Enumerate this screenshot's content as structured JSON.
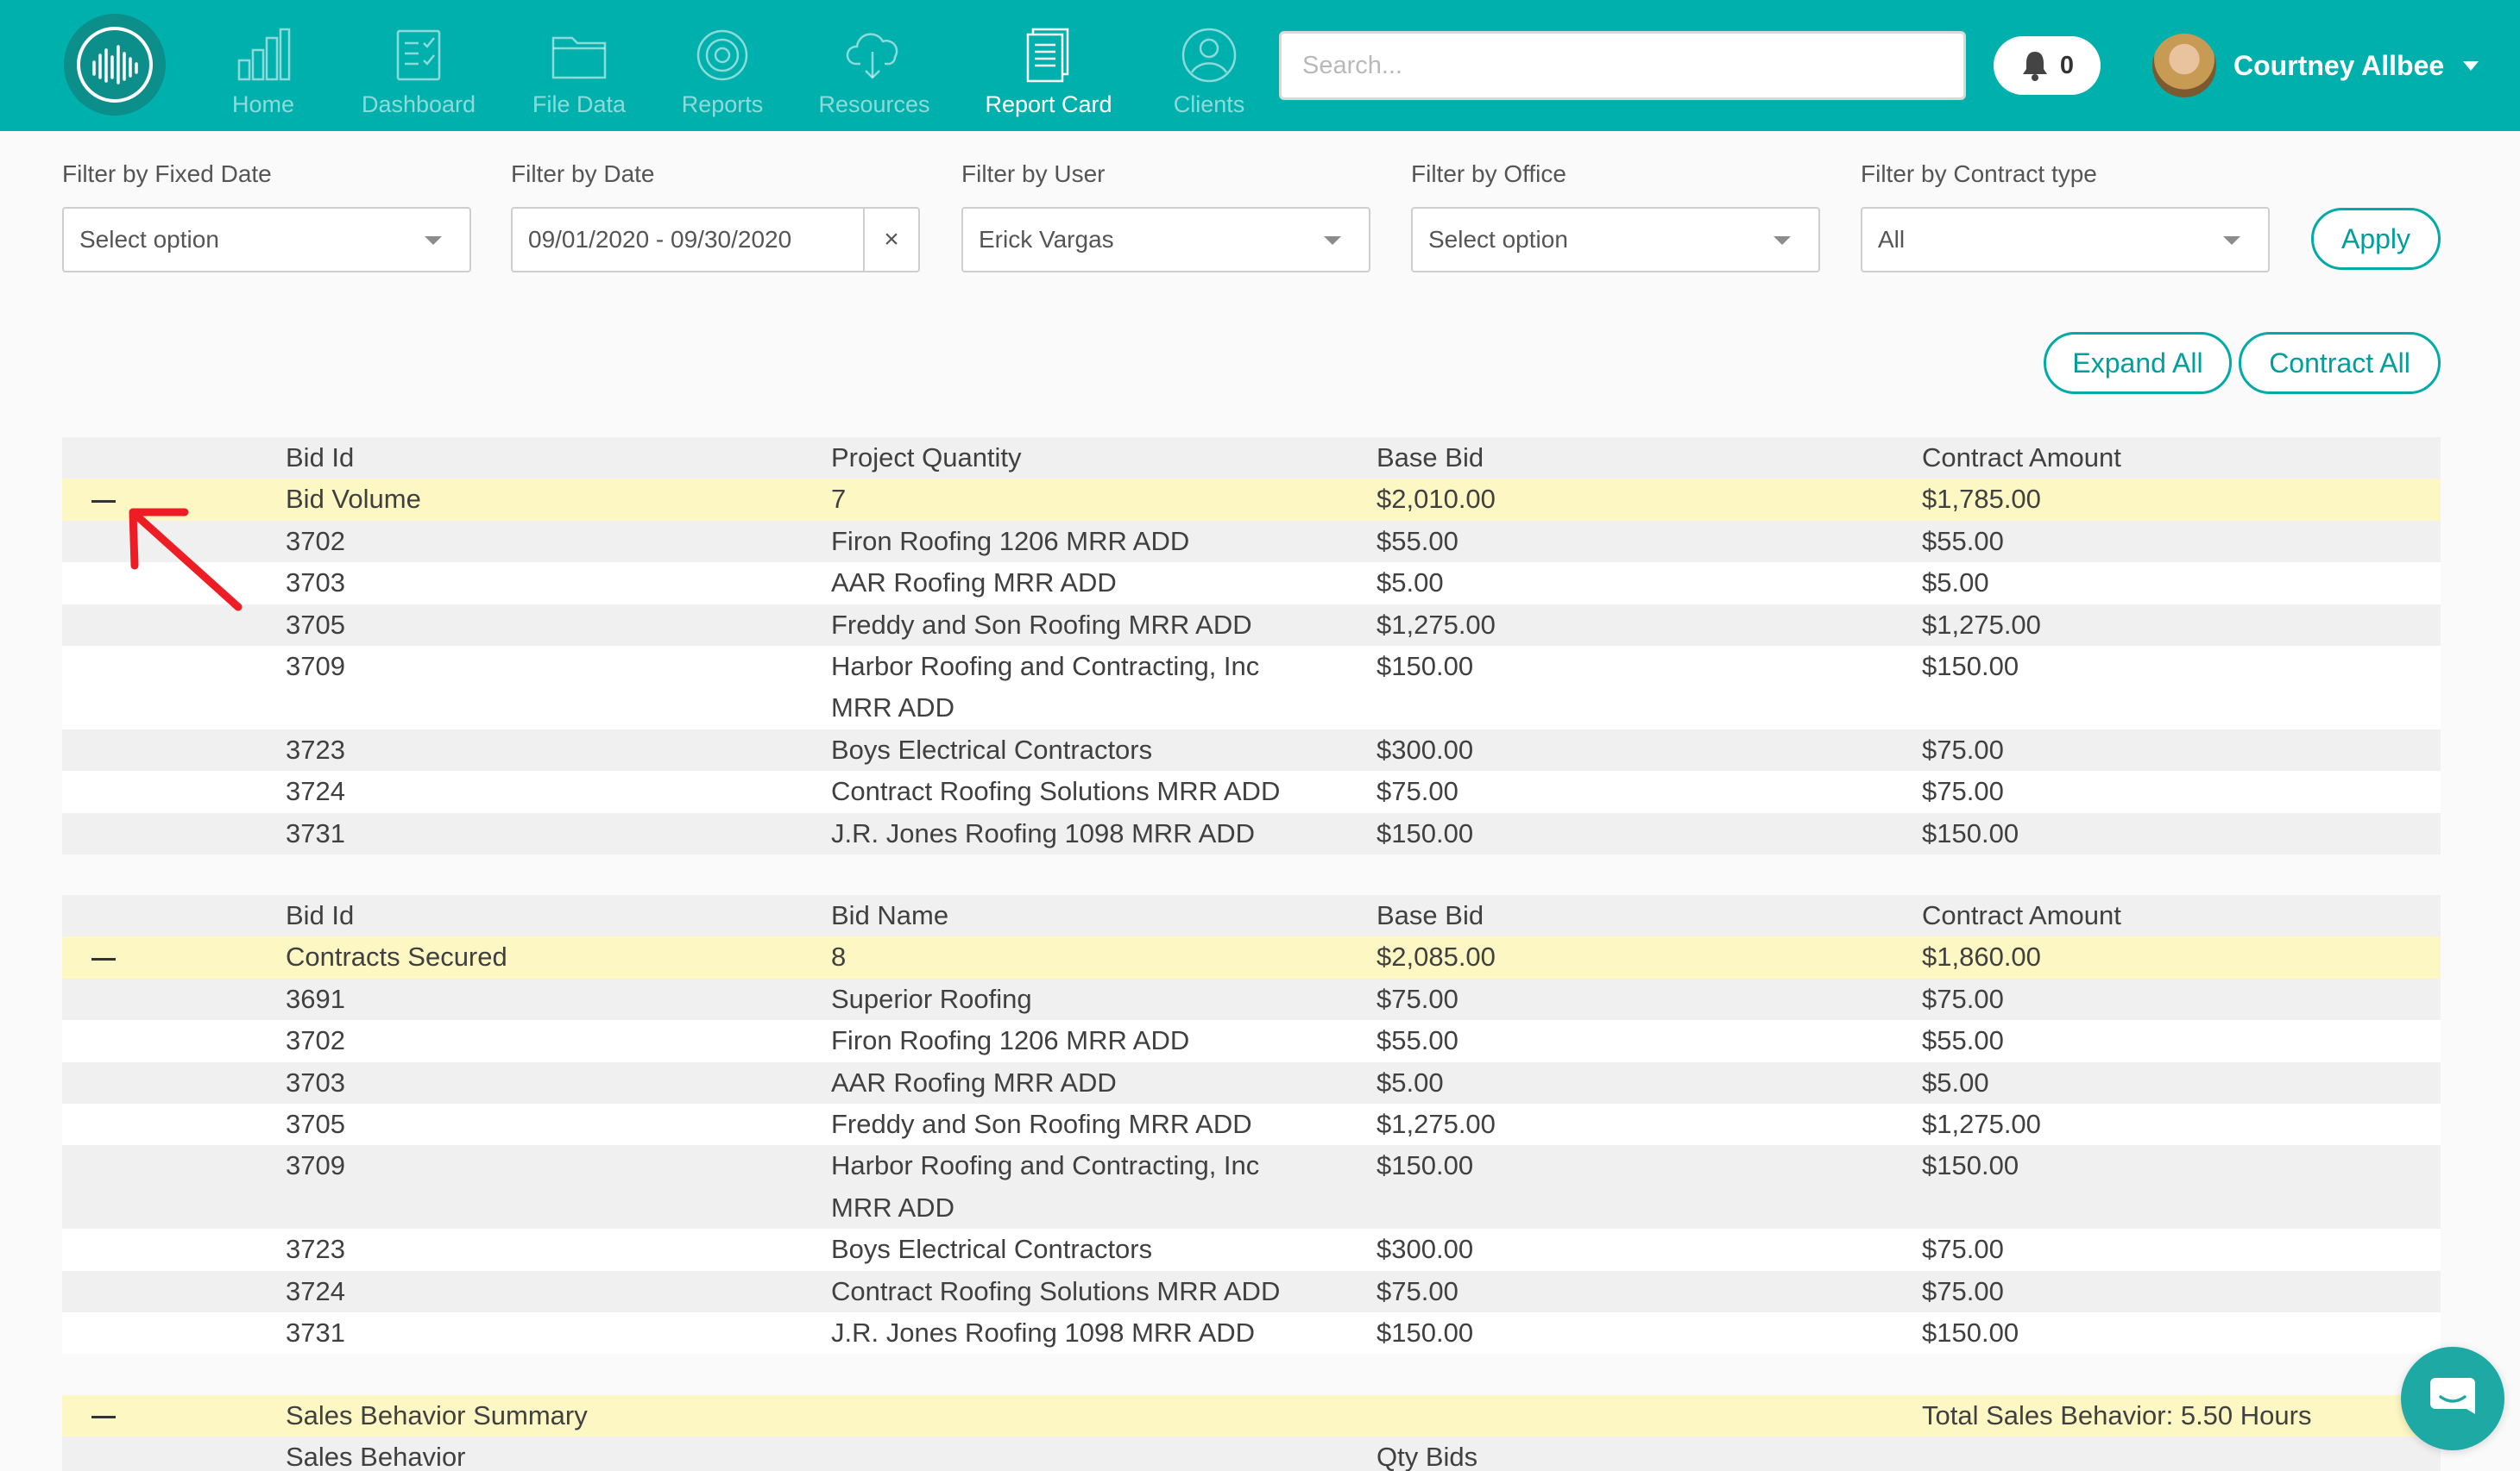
{
  "nav": {
    "items": [
      {
        "label": "Home",
        "icon": "bar-chart-icon"
      },
      {
        "label": "Dashboard",
        "icon": "clipboard-check-icon"
      },
      {
        "label": "File Data",
        "icon": "folder-icon"
      },
      {
        "label": "Reports",
        "icon": "target-icon"
      },
      {
        "label": "Resources",
        "icon": "cloud-download-icon"
      },
      {
        "label": "Report Card",
        "icon": "document-icon"
      },
      {
        "label": "Clients",
        "icon": "user-circle-icon"
      }
    ],
    "active": "Report Card",
    "search_placeholder": "Search...",
    "notification_count": "0",
    "user_name": "Courtney Allbee"
  },
  "filters": {
    "fixed_date": {
      "label": "Filter by Fixed Date",
      "value": "Select option"
    },
    "date": {
      "label": "Filter by Date",
      "value": "09/01/2020 - 09/30/2020",
      "clear": "×"
    },
    "user": {
      "label": "Filter by User",
      "value": "Erick Vargas"
    },
    "office": {
      "label": "Filter by Office",
      "value": "Select option"
    },
    "contract_type": {
      "label": "Filter by Contract type",
      "value": "All"
    },
    "apply_label": "Apply"
  },
  "actions": {
    "expand_all": "Expand All",
    "contract_all": "Contract All"
  },
  "bid_volume": {
    "headers": [
      "Bid Id",
      "Project Quantity",
      "Base Bid",
      "Contract Amount"
    ],
    "total": {
      "label": "Bid Volume",
      "quantity": "7",
      "base_bid": "$2,010.00",
      "contract_amount": "$1,785.00"
    },
    "rows": [
      {
        "id": "3702",
        "name": "Firon Roofing 1206 MRR ADD",
        "base": "$55.00",
        "contract": "$55.00"
      },
      {
        "id": "3703",
        "name": "AAR Roofing MRR ADD",
        "base": "$5.00",
        "contract": "$5.00"
      },
      {
        "id": "3705",
        "name": "Freddy and Son Roofing MRR ADD",
        "base": "$1,275.00",
        "contract": "$1,275.00"
      },
      {
        "id": "3709",
        "name": "Harbor Roofing and Contracting, Inc MRR ADD",
        "base": "$150.00",
        "contract": "$150.00"
      },
      {
        "id": "3723",
        "name": "Boys Electrical Contractors",
        "base": "$300.00",
        "contract": "$75.00"
      },
      {
        "id": "3724",
        "name": "Contract Roofing Solutions MRR ADD",
        "base": "$75.00",
        "contract": "$75.00"
      },
      {
        "id": "3731",
        "name": "J.R. Jones Roofing 1098 MRR ADD",
        "base": "$150.00",
        "contract": "$150.00"
      }
    ]
  },
  "contracts_secured": {
    "headers": [
      "Bid Id",
      "Bid Name",
      "Base Bid",
      "Contract Amount"
    ],
    "total": {
      "label": "Contracts Secured",
      "quantity": "8",
      "base_bid": "$2,085.00",
      "contract_amount": "$1,860.00"
    },
    "rows": [
      {
        "id": "3691",
        "name": "Superior Roofing",
        "base": "$75.00",
        "contract": "$75.00"
      },
      {
        "id": "3702",
        "name": "Firon Roofing 1206 MRR ADD",
        "base": "$55.00",
        "contract": "$55.00"
      },
      {
        "id": "3703",
        "name": "AAR Roofing MRR ADD",
        "base": "$5.00",
        "contract": "$5.00"
      },
      {
        "id": "3705",
        "name": "Freddy and Son Roofing MRR ADD",
        "base": "$1,275.00",
        "contract": "$1,275.00"
      },
      {
        "id": "3709",
        "name": "Harbor Roofing and Contracting, Inc MRR ADD",
        "base": "$150.00",
        "contract": "$150.00"
      },
      {
        "id": "3723",
        "name": "Boys Electrical Contractors",
        "base": "$300.00",
        "contract": "$75.00"
      },
      {
        "id": "3724",
        "name": "Contract Roofing Solutions MRR ADD",
        "base": "$75.00",
        "contract": "$75.00"
      },
      {
        "id": "3731",
        "name": "J.R. Jones Roofing 1098 MRR ADD",
        "base": "$150.00",
        "contract": "$150.00"
      }
    ]
  },
  "sales_behavior": {
    "label": "Sales Behavior Summary",
    "total": "Total Sales Behavior: 5.50 Hours",
    "headers": [
      "Sales Behavior",
      "Qty Bids"
    ]
  },
  "colors": {
    "brand": "#00b0ad",
    "total_row": "#fdf7c3",
    "annotation": "#ee1c25"
  }
}
